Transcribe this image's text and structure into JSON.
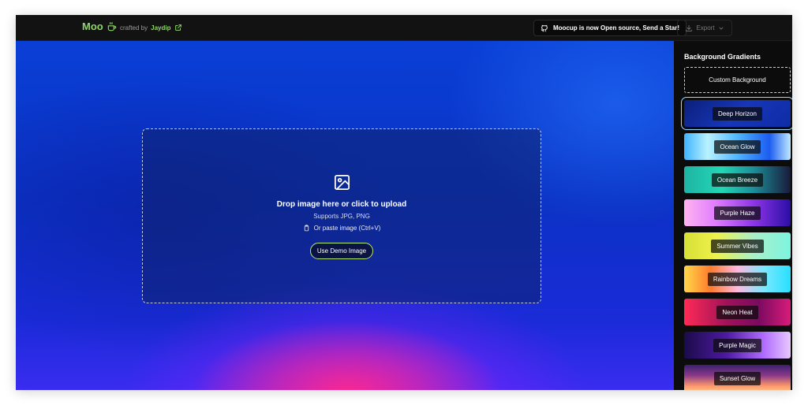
{
  "header": {
    "brand": "Moo",
    "crafted_by": "crafted by",
    "author": "Jaydip",
    "oss_button": "Moocup is now Open source, Send a Star!",
    "export_button": "Export"
  },
  "dropzone": {
    "title": "Drop image here or click to upload",
    "subtitle": "Supports JPG, PNG",
    "paste_hint": "Or paste image (Ctrl+V)",
    "demo_button": "Use Demo Image"
  },
  "sidebar": {
    "title": "Background Gradients",
    "custom_background": "Custom Background",
    "gradients": [
      {
        "label": "Deep Horizon",
        "selected": true
      },
      {
        "label": "Ocean Glow"
      },
      {
        "label": "Ocean Breeze"
      },
      {
        "label": "Purple Haze"
      },
      {
        "label": "Summer Vibes"
      },
      {
        "label": "Rainbow Dreams"
      },
      {
        "label": "Neon Heat"
      },
      {
        "label": "Purple Magic"
      },
      {
        "label": "Sunset Glow"
      }
    ]
  },
  "colors": {
    "brand_green": "#8fd46a",
    "accent_outline": "#b7e86f",
    "selected_outline": "#9ad7ff"
  },
  "icons": [
    "coffee-cup-icon",
    "external-link-icon",
    "github-icon",
    "download-icon",
    "chevron-down-icon",
    "image-icon",
    "clipboard-icon"
  ]
}
